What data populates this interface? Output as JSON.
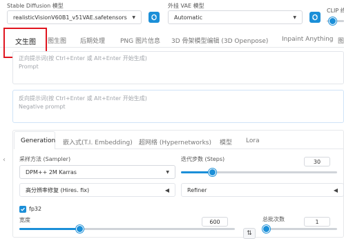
{
  "top": {
    "model_label": "Stable Diffusion 模型",
    "model_value": "realisticVisionV60B1_v51VAE.safetensors",
    "vae_label": "外挂 VAE 模型",
    "vae_value": "Automatic",
    "clip_label": "CLIP 终"
  },
  "tabs": [
    {
      "label": "文生图"
    },
    {
      "label": "图生图"
    },
    {
      "label": "后期处理"
    },
    {
      "label": "PNG 图片信息"
    },
    {
      "label": "3D 骨架模型编辑 (3D Openpose)"
    },
    {
      "label": "Inpaint Anything"
    },
    {
      "label": "图"
    }
  ],
  "prompt": {
    "placeholder_cn": "正向提示词(按 Ctrl+Enter 或 Alt+Enter 开始生成)",
    "placeholder_en": "Prompt"
  },
  "negative": {
    "placeholder_cn": "反向提示词(按 Ctrl+Enter 或 Alt+Enter 开始生成)",
    "placeholder_en": "Negative prompt"
  },
  "subtabs": [
    {
      "label": "Generation"
    },
    {
      "label": "嵌入式(T.I. Embedding)"
    },
    {
      "label": "超网络 (Hypernetworks)"
    },
    {
      "label": "模型"
    },
    {
      "label": "Lora"
    }
  ],
  "sampler": {
    "label": "采样方法 (Sampler)",
    "value": "DPM++ 2M Karras"
  },
  "steps": {
    "label": "迭代步数 (Steps)",
    "value": "30",
    "fraction": 0.2
  },
  "hires": {
    "label": "高分辨率修复 (Hires. fix)"
  },
  "refiner": {
    "label": "Refiner"
  },
  "fp32": {
    "label": "fp32",
    "checked": true
  },
  "width": {
    "label": "宽度",
    "value": "600",
    "fraction": 0.28
  },
  "batch_count": {
    "label": "总批次数",
    "value": "1",
    "fraction": 0.0
  },
  "swap_icon_text": "⇅",
  "left_arrow": "‹"
}
